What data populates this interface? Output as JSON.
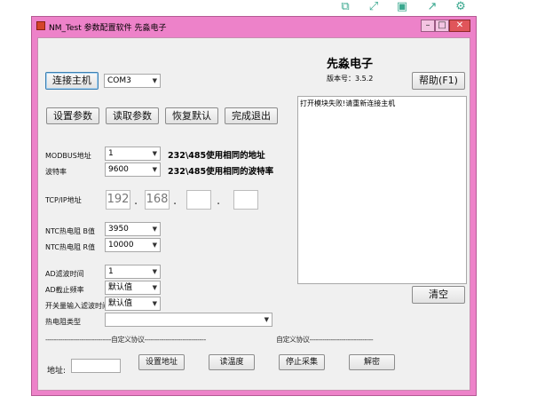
{
  "window": {
    "title": "NM_Test  参数配置软件  先淼电子",
    "minimize_glyph": "–",
    "maximize_glyph": "□",
    "close_glyph": "✕"
  },
  "brand": {
    "name": "先淼电子",
    "version": "版本号：3.5.2"
  },
  "buttons": {
    "connect": "连接主机",
    "help": "帮助(F1)",
    "set_params": "设置参数",
    "read_params": "读取参数",
    "restore_default": "恢复默认",
    "finish_exit": "完成退出",
    "clear": "清空",
    "set_address": "设置地址",
    "read_temperature": "读温度",
    "stop_collect": "停止采集",
    "decrypt": "解密"
  },
  "port": {
    "selected": "COM3"
  },
  "log": {
    "text": "打开模块失败!请重新连接主机"
  },
  "fields": {
    "modbus_label": "MODBUS地址",
    "modbus_value": "1",
    "modbus_note": "232\\485使用相同的地址",
    "baud_label": "波特率",
    "baud_value": "9600",
    "baud_note": "232\\485使用相同的波特率",
    "tcp_label": "TCP/IP地址",
    "ip_1": "192",
    "ip_2": "168",
    "ip_3": "",
    "ip_4": "",
    "ntc_b_label": "NTC热电阻 B值",
    "ntc_b_value": "3950",
    "ntc_r_label": "NTC热电阻 R值",
    "ntc_r_value": "10000",
    "ad_time_label": "AD滤波时间",
    "ad_time_value": "1",
    "ad_freq_label": "AD截止频率",
    "ad_freq_value": "默认值",
    "switch_label": "开关量输入滤波时间",
    "switch_value": "默认值",
    "thermistor_label": "热电阻类型",
    "thermistor_value": ""
  },
  "protocol": {
    "divider_left": "-------------------------------自定义协议-----------------------------",
    "divider_right": "自定义协议------------------------------",
    "address_label": "地址:",
    "address_value": ""
  },
  "toolbar_icons": [
    "copy-icon",
    "expand-icon",
    "save-icon",
    "share-icon",
    "gear-icon"
  ]
}
